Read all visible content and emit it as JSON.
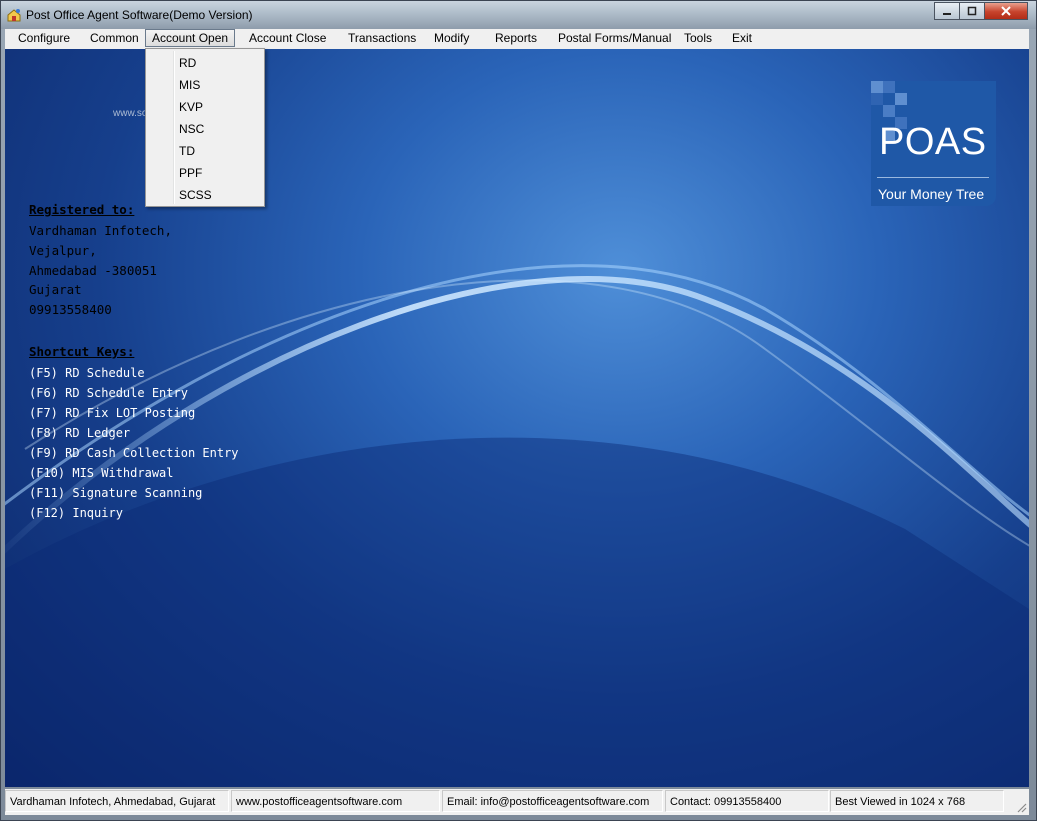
{
  "window": {
    "title": "Post Office Agent Software(Demo Version)"
  },
  "menu": {
    "items": [
      {
        "label": "Configure"
      },
      {
        "label": "Common"
      },
      {
        "label": "Account Open"
      },
      {
        "label": "Account Close"
      },
      {
        "label": "Transactions"
      },
      {
        "label": "Modify"
      },
      {
        "label": "Reports"
      },
      {
        "label": "Postal Forms/Manual"
      },
      {
        "label": "Tools"
      },
      {
        "label": "Exit"
      }
    ],
    "open_menu": "Account Open"
  },
  "dropdown": {
    "items": [
      {
        "label": "RD"
      },
      {
        "label": "MIS"
      },
      {
        "label": "KVP"
      },
      {
        "label": "NSC"
      },
      {
        "label": "TD"
      },
      {
        "label": "PPF"
      },
      {
        "label": "SCSS"
      }
    ]
  },
  "registration": {
    "heading": "Registered to:",
    "lines": [
      "Vardhaman Infotech,",
      "Vejalpur,",
      "Ahmedabad -380051",
      "Gujarat",
      "09913558400"
    ]
  },
  "shortcuts": {
    "heading": "Shortcut Keys:",
    "items": [
      "(F5) RD Schedule",
      "(F6) RD Schedule Entry",
      "(F7) RD Fix LOT Posting",
      "(F8) RD Ledger",
      "(F9) RD Cash Collection Entry",
      "(F10) MIS Withdrawal",
      "(F11) Signature Scanning",
      "(F12) Inquiry"
    ]
  },
  "logo": {
    "title": "POAS",
    "tagline": "Your Money Tree"
  },
  "watermark": "www.softpedia.com",
  "status": {
    "cells": [
      "Vardhaman Infotech, Ahmedabad, Gujarat",
      "www.postofficeagentsoftware.com",
      "Email: info@postofficeagentsoftware.com",
      "Contact: 09913558400",
      "Best Viewed in 1024 x 768"
    ]
  },
  "colors": {
    "background_accent": "#1f58a7",
    "shortcut_text": "#ffffff",
    "registration_text": "#000000"
  }
}
